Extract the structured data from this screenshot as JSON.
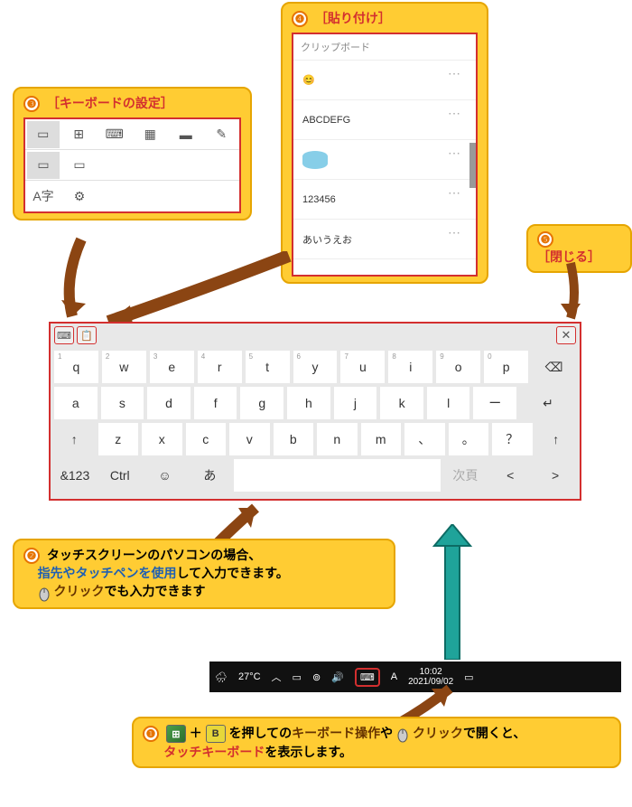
{
  "callouts": {
    "c3": {
      "num": "❸",
      "label": "［キーボードの設定］"
    },
    "c4": {
      "num": "❹",
      "label": "［貼り付け］"
    },
    "c5": {
      "num": "❺",
      "label": "［閉じる］"
    },
    "c2": {
      "num": "❷",
      "line1": "タッチスクリーンのパソコンの場合、",
      "line2_hl": "指先やタッチペンを使用",
      "line2_rest": "して入力できます。",
      "line3_a": "クリック",
      "line3_b": "でも入力できます"
    },
    "c1": {
      "num": "❶",
      "plus": "＋",
      "keyB": "B",
      "t1": "を押しての",
      "t2": "キーボード操作",
      "t3": "や",
      "t4": "クリック",
      "t5": "で開くと、",
      "t6": "タッチキーボード",
      "t7": "を表示します。"
    }
  },
  "clipboard": {
    "header": "クリップボード",
    "items": [
      "😊",
      "ABCDEFG",
      "",
      "123456",
      "あいうえお"
    ]
  },
  "kb_settings": {
    "row3_label": "A字"
  },
  "keyboard": {
    "row1": [
      {
        "n": "1",
        "l": "q"
      },
      {
        "n": "2",
        "l": "w"
      },
      {
        "n": "3",
        "l": "e"
      },
      {
        "n": "4",
        "l": "r"
      },
      {
        "n": "5",
        "l": "t"
      },
      {
        "n": "6",
        "l": "y"
      },
      {
        "n": "7",
        "l": "u"
      },
      {
        "n": "8",
        "l": "i"
      },
      {
        "n": "9",
        "l": "o"
      },
      {
        "n": "0",
        "l": "p"
      }
    ],
    "backspace": "⌫",
    "row2": [
      "a",
      "s",
      "d",
      "f",
      "g",
      "h",
      "j",
      "k",
      "l",
      "ー"
    ],
    "enter": "↵",
    "row3_shift": "↑",
    "row3": [
      "z",
      "x",
      "c",
      "v",
      "b",
      "n",
      "m",
      "、",
      "。",
      "？"
    ],
    "row3_shift2": "↑",
    "row4": {
      "sym": "&123",
      "ctrl": "Ctrl",
      "emoji": "☺",
      "kana": "あ",
      "next": "次頁",
      "left": "<",
      "right": ">"
    }
  },
  "taskbar": {
    "weather": "🌧",
    "temp": "27°C",
    "ime": "A",
    "time": "10:02",
    "date": "2021/09/02"
  }
}
